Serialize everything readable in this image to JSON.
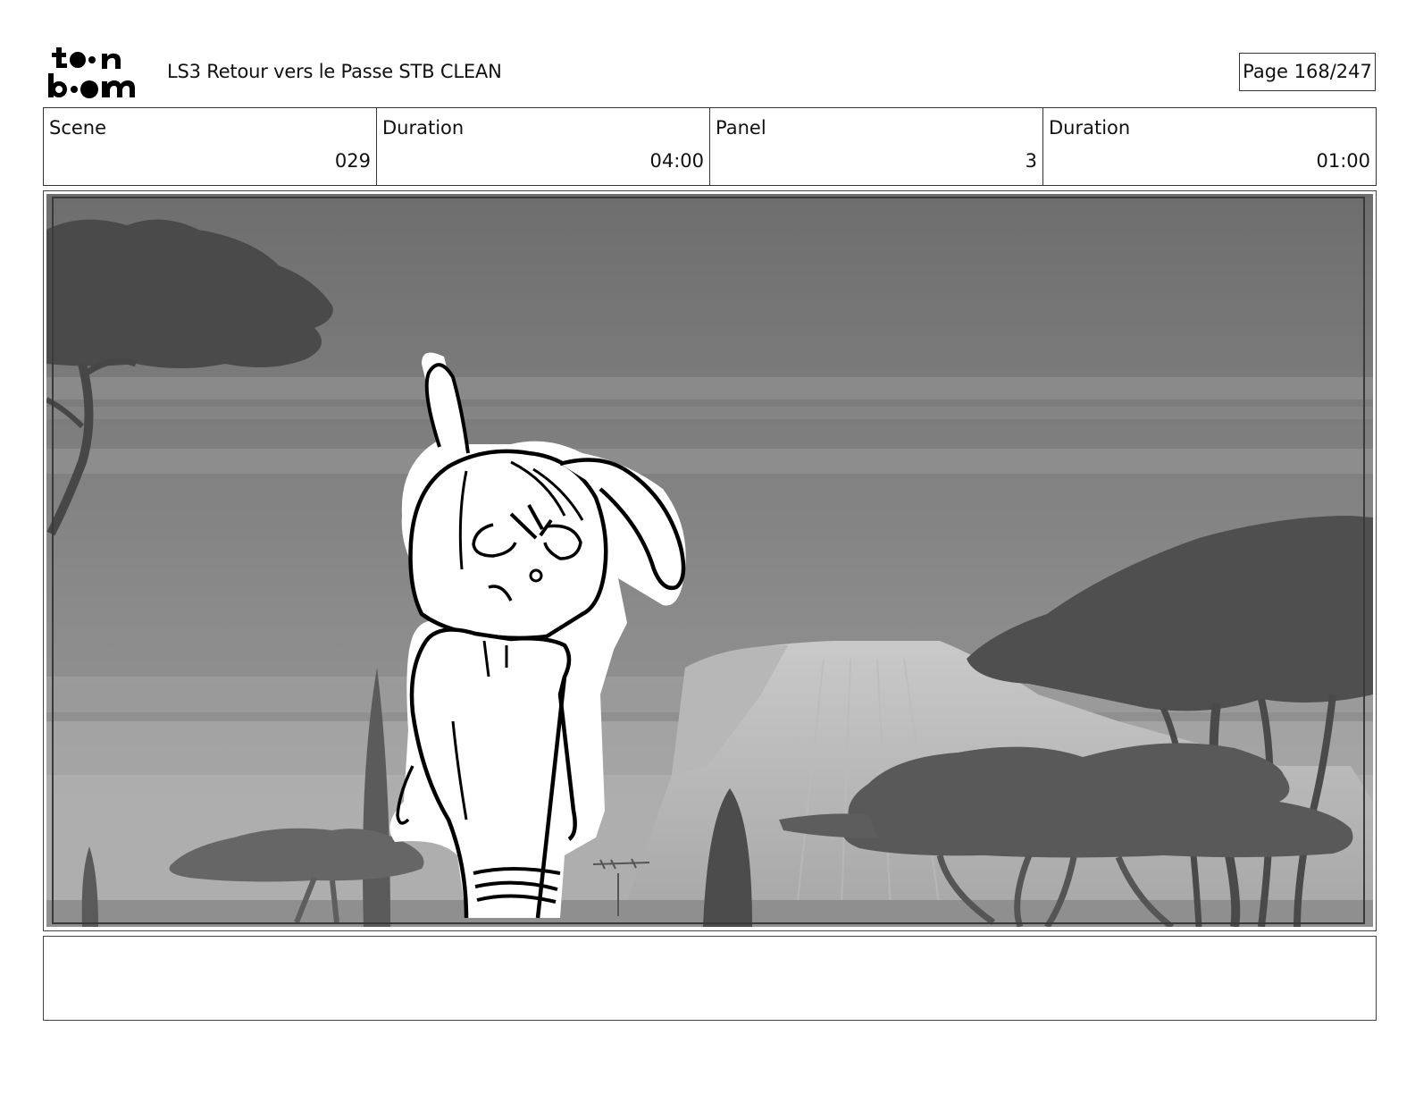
{
  "header": {
    "logo_alt": "toon boom",
    "title": "LS3 Retour vers le Passe STB CLEAN",
    "page": "Page 168/247"
  },
  "info": {
    "scene_label": "Scene",
    "scene_value": "029",
    "scene_duration_label": "Duration",
    "scene_duration_value": "04:00",
    "panel_label": "Panel",
    "panel_value": "3",
    "panel_duration_label": "Duration",
    "panel_duration_value": "01:00"
  },
  "caption": {
    "text": ""
  }
}
